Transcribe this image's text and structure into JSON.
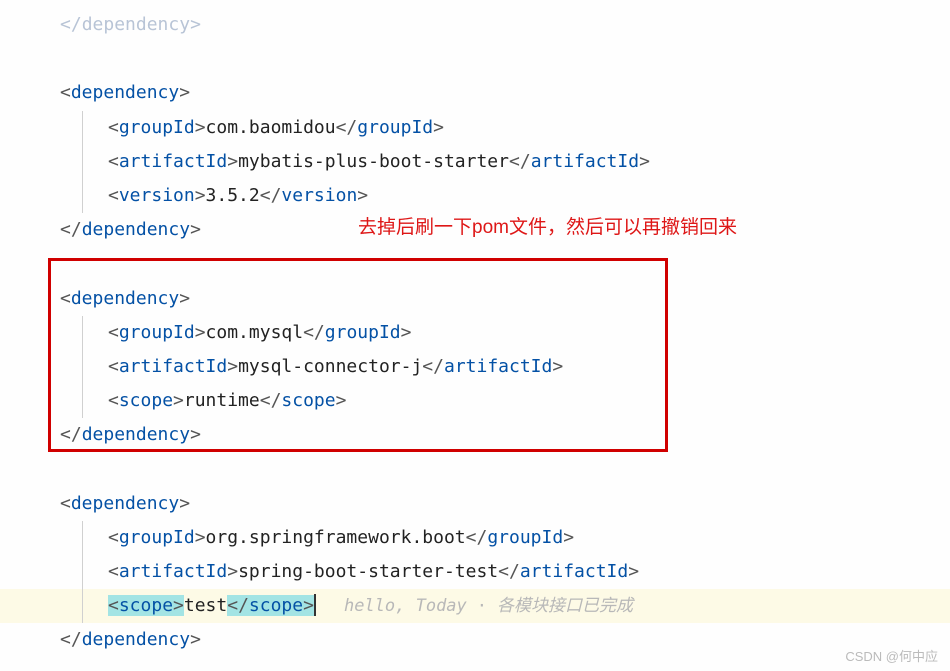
{
  "code": {
    "closeDep": "dependency",
    "dep1": {
      "open": "dependency",
      "groupId_tag": "groupId",
      "groupId_val": "com.baomidou",
      "artifactId_tag": "artifactId",
      "artifactId_val": "mybatis-plus-boot-starter",
      "version_tag": "version",
      "version_val": "3.5.2",
      "close": "dependency"
    },
    "dep2": {
      "open": "dependency",
      "groupId_tag": "groupId",
      "groupId_val": "com.mysql",
      "artifactId_tag": "artifactId",
      "artifactId_val": "mysql-connector-j",
      "scope_tag": "scope",
      "scope_val": "runtime",
      "close": "dependency"
    },
    "dep3": {
      "open": "dependency",
      "groupId_tag": "groupId",
      "groupId_val": "org.springframework.boot",
      "artifactId_tag": "artifactId",
      "artifactId_val": "spring-boot-starter-test",
      "scope_tag": "scope",
      "scope_val": "test",
      "close": "dependency"
    }
  },
  "annotation": "去掉后刷一下pom文件，然后可以再撤销回来",
  "inline_hint": {
    "text1": "hello, Today",
    "text2": "各模块接口已完成"
  },
  "watermark": "CSDN @何中应",
  "brackets": {
    "lt": "<",
    "gt": ">",
    "ltc": "</"
  }
}
